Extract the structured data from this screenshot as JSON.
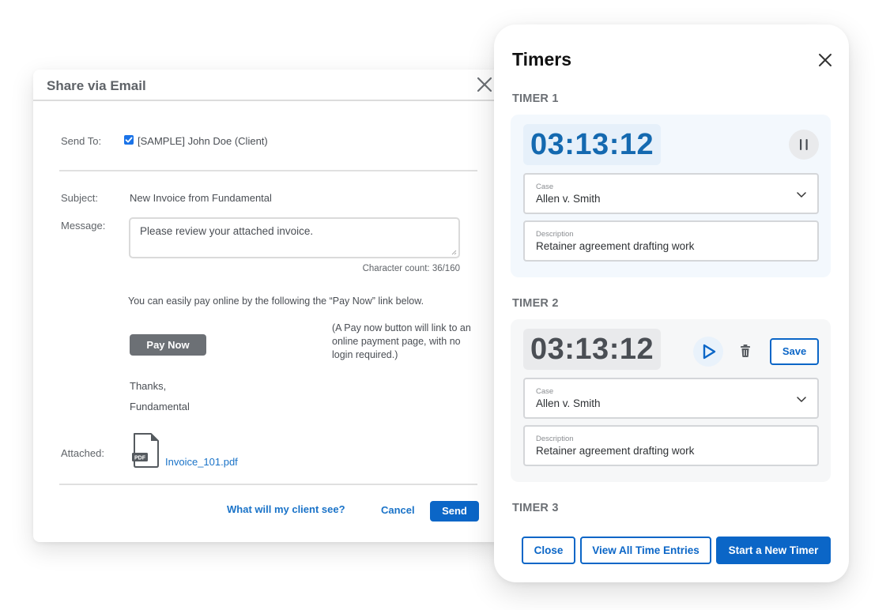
{
  "email_dialog": {
    "title": "Share via Email",
    "send_to_label": "Send To:",
    "recipient": {
      "label": "[SAMPLE] John Doe (Client)",
      "checked": true
    },
    "subject_label": "Subject:",
    "subject_value": "New Invoice from Fundamental",
    "message_label": "Message:",
    "message_value": "Please review your attached invoice.",
    "character_count": "Character count: 36/160",
    "pay_note": "You can easily pay online by the following the “Pay Now” link below.",
    "pay_now_label": "Pay Now",
    "pay_hint": "(A Pay now button will link to an online payment page, with no login required.)",
    "thanks": "Thanks,",
    "signature": "Fundamental",
    "attached_label": "Attached:",
    "attachment_badge": "PDF",
    "attachment_name": "Invoice_101.pdf",
    "client_preview_link": "What will my client see?",
    "cancel_label": "Cancel",
    "send_label": "Send"
  },
  "timers_panel": {
    "title": "Timers",
    "timers": [
      {
        "label": "TIMER 1",
        "time": "03:13:12",
        "state": "running",
        "case_label": "Case",
        "case_value": "Allen v. Smith",
        "description_label": "Description",
        "description_value": "Retainer agreement drafting work"
      },
      {
        "label": "TIMER 2",
        "time": "03:13:12",
        "state": "paused",
        "save_label": "Save",
        "case_label": "Case",
        "case_value": "Allen v. Smith",
        "description_label": "Description",
        "description_value": "Retainer agreement drafting work"
      },
      {
        "label": "TIMER 3"
      }
    ],
    "buttons": {
      "close": "Close",
      "view_all": "View All Time Entries",
      "start_new": "Start a New Timer"
    }
  },
  "colors": {
    "primary_blue": "#0b66c7",
    "running_time_blue": "#1469b0",
    "link_blue": "#1a73c8",
    "pay_now_gray": "#6c7075"
  }
}
